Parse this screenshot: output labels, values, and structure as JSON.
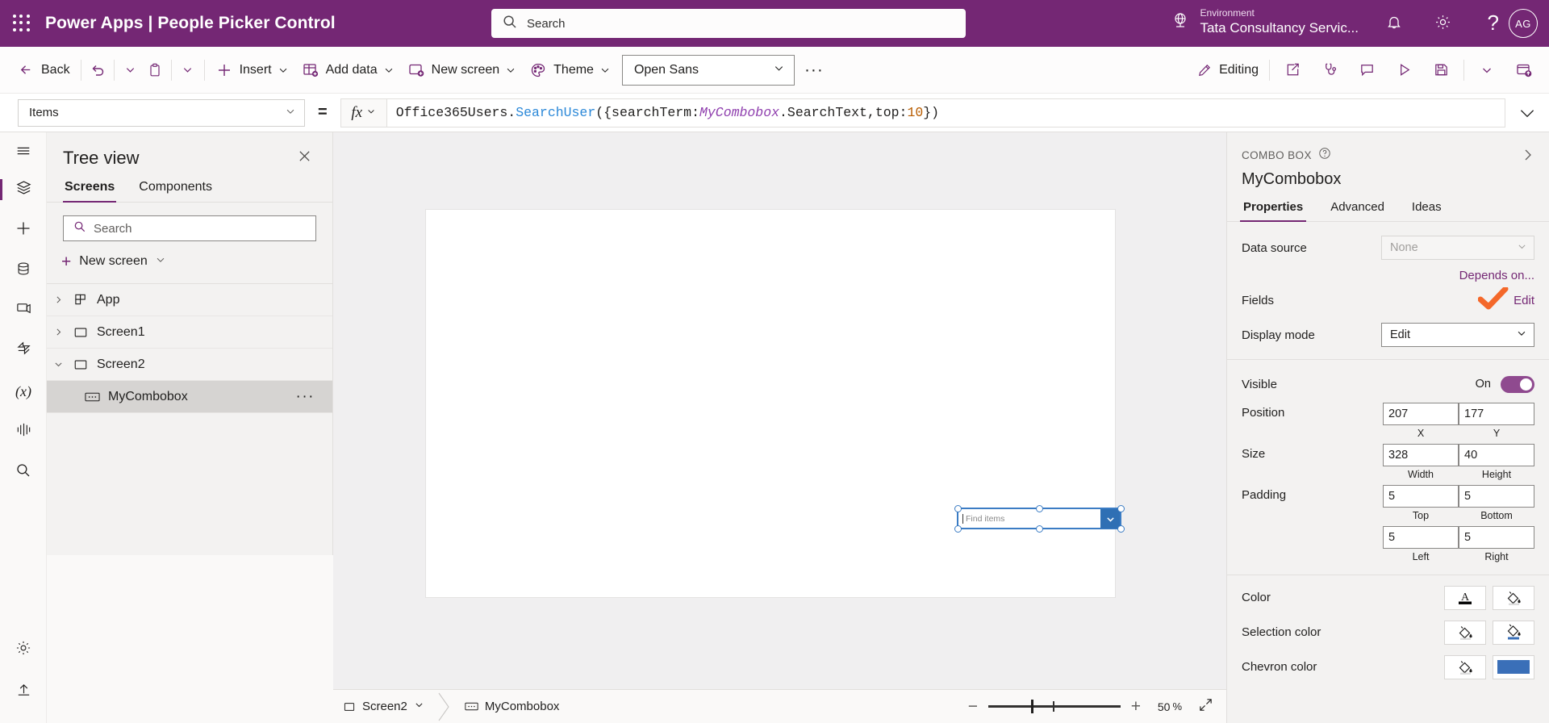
{
  "topbar": {
    "waffle_icon": "waffle-grid-icon",
    "product": "Power Apps",
    "divider": "|",
    "app_name": "People Picker Control",
    "title_full": "Power Apps  |  People Picker Control",
    "search_placeholder": "Search",
    "search_icon": "search-icon",
    "environment_label": "Environment",
    "environment_name": "Tata Consultancy Servic...",
    "globe_icon": "globe-environment-icon",
    "notifications_icon": "bell-icon",
    "settings_icon": "gear-icon",
    "help_icon": "question-mark-icon",
    "avatar_initials": "AG",
    "bg_color": "#742774"
  },
  "commandbar": {
    "back": "Back",
    "undo_icon": "undo-icon",
    "undo_caret_icon": "chevron-down-icon",
    "paste_icon": "clipboard-paste-icon",
    "paste_caret_icon": "chevron-down-icon",
    "insert": "Insert",
    "insert_icon": "plus-icon",
    "add_data": "Add data",
    "add_data_icon": "table-add-icon",
    "new_screen": "New screen",
    "new_screen_icon": "screen-add-icon",
    "theme": "Theme",
    "theme_icon": "palette-icon",
    "font_value": "Open Sans",
    "overflow": "···",
    "editing": "Editing",
    "editing_icon": "pencil-icon",
    "share_icon": "share-icon",
    "app_checker_icon": "stethoscope-icon",
    "comments_icon": "comment-icon",
    "preview_icon": "play-icon",
    "save_icon": "save-disk-icon",
    "save_caret_icon": "chevron-down-icon",
    "publish_icon": "publish-cloud-icon"
  },
  "formulabar": {
    "property": "Items",
    "equals": "=",
    "fx_label": "fx",
    "fx_caret_icon": "chevron-down-icon",
    "formula": "Office365Users.SearchUser({searchTerm:MyCombobox.SearchText,top:10})",
    "formula_tokens": {
      "t1": "Office365Users.",
      "t2": "SearchUser",
      "t3": "({searchTerm:",
      "t4": "MyCombobox",
      "t5": ".SearchText,top:",
      "t6": "10",
      "t7": "})"
    },
    "collapse_icon": "chevron-down-icon"
  },
  "rail": {
    "items": [
      {
        "name": "hamburger-menu-icon"
      },
      {
        "name": "layers-tree-view-icon"
      },
      {
        "name": "insert-plus-icon"
      },
      {
        "name": "data-cylinder-icon"
      },
      {
        "name": "media-icon"
      },
      {
        "name": "power-automate-icon"
      },
      {
        "name": "variables-x-icon"
      },
      {
        "name": "components-icon"
      },
      {
        "name": "search-icon"
      },
      {
        "name": "settings-gear-icon"
      },
      {
        "name": "publish-icon"
      }
    ]
  },
  "treeview": {
    "title": "Tree view",
    "close_icon": "close-icon",
    "tabs": [
      {
        "label": "Screens",
        "active": true
      },
      {
        "label": "Components",
        "active": false
      }
    ],
    "search_placeholder": "Search",
    "search_icon": "search-icon",
    "new_screen": "New screen",
    "new_screen_plus_icon": "plus-icon",
    "new_screen_caret_icon": "chevron-down-icon",
    "rows": [
      {
        "label": "App",
        "icon": "app-grid-icon",
        "caret": "chevron-right-icon",
        "indent": 0,
        "selected": false,
        "more": false
      },
      {
        "label": "Screen1",
        "icon": "screen-icon",
        "caret": "chevron-right-icon",
        "indent": 0,
        "selected": false,
        "more": false
      },
      {
        "label": "Screen2",
        "icon": "screen-icon",
        "caret": "chevron-down-icon",
        "indent": 0,
        "selected": false,
        "more": false
      },
      {
        "label": "MyCombobox",
        "icon": "combobox-icon",
        "caret": "",
        "indent": 1,
        "selected": true,
        "more": true
      }
    ],
    "more_glyph": "···"
  },
  "canvas": {
    "combobox_placeholder": "Find items",
    "combobox_chevron_icon": "chevron-down-icon",
    "chevron_bg": "#2f6fb4",
    "selection_color": "#3b7cc4"
  },
  "statusbar": {
    "screen_name": "Screen2",
    "screen_icon": "screen-icon",
    "screen_caret_icon": "chevron-down-icon",
    "control_name": "MyCombobox",
    "control_icon": "combobox-icon",
    "zoom_out_icon": "minus-icon",
    "zoom_in_icon": "plus-icon",
    "zoom_value": "50",
    "zoom_unit": "%",
    "fit_icon": "expand-diagonal-icon"
  },
  "properties": {
    "kicker": "COMBO BOX",
    "help_icon": "question-circle-icon",
    "expand_icon": "chevron-right-icon",
    "control_name": "MyCombobox",
    "tabs": [
      {
        "label": "Properties",
        "active": true
      },
      {
        "label": "Advanced",
        "active": false
      },
      {
        "label": "Ideas",
        "active": false
      }
    ],
    "data_source_label": "Data source",
    "data_source_value": "None",
    "data_source_caret_icon": "chevron-down-icon",
    "depends_on": "Depends on...",
    "fields_label": "Fields",
    "fields_edit": "Edit",
    "annotation_icon": "orange-checkmark-annotation",
    "annotation_color": "#F4682A",
    "display_mode_label": "Display mode",
    "display_mode_value": "Edit",
    "display_mode_caret_icon": "chevron-down-icon",
    "visible_label": "Visible",
    "visible_state": "On",
    "visible_toggle_icon": "toggle-switch-on",
    "position_label": "Position",
    "position_x": "207",
    "position_y": "177",
    "position_x_caption": "X",
    "position_y_caption": "Y",
    "size_label": "Size",
    "size_width": "328",
    "size_height": "40",
    "size_width_caption": "Width",
    "size_height_caption": "Height",
    "padding_label": "Padding",
    "padding_top": "5",
    "padding_bottom": "5",
    "padding_left": "5",
    "padding_right": "5",
    "padding_top_caption": "Top",
    "padding_bottom_caption": "Bottom",
    "padding_left_caption": "Left",
    "padding_right_caption": "Right",
    "color_label": "Color",
    "color_text_icon": "font-color-A-icon",
    "color_fill_icon": "paint-bucket-icon",
    "selection_color_label": "Selection color",
    "selection_fill_icon": "paint-bucket-icon",
    "selection_fill_blue_icon": "paint-bucket-blue-underline-icon",
    "chevron_color_label": "Chevron color",
    "chevron_fill_icon": "paint-bucket-icon",
    "chevron_swatch_color": "#3A6FB8"
  }
}
